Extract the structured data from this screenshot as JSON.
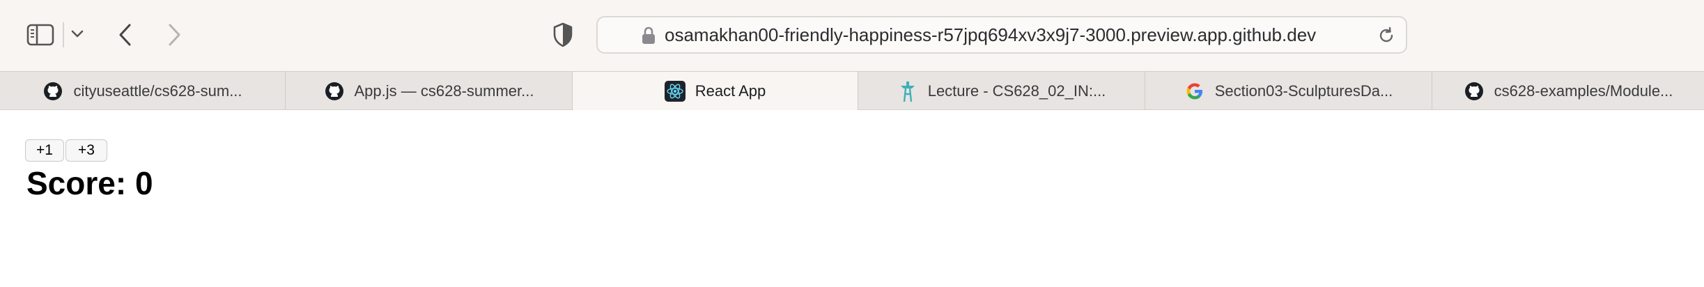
{
  "browser": {
    "url": "osamakhan00-friendly-happiness-r57jpq694xv3x9j7-3000.preview.app.github.dev",
    "tabs": [
      {
        "label": "cityuseattle/cs628-sum...",
        "icon": "github-icon",
        "active": false
      },
      {
        "label": "App.js — cs628-summer...",
        "icon": "github-icon",
        "active": false
      },
      {
        "label": "React App",
        "icon": "react-icon",
        "active": true
      },
      {
        "label": "Lecture - CS628_02_IN:...",
        "icon": "space-needle-icon",
        "active": false
      },
      {
        "label": "Section03-SculpturesDa...",
        "icon": "google-icon",
        "active": false
      },
      {
        "label": "cs628-examples/Module...",
        "icon": "github-icon",
        "active": false
      }
    ]
  },
  "page": {
    "plus_one_label": "+1",
    "plus_three_label": "+3",
    "score_text": "Score: 0"
  },
  "colors": {
    "toolbar_bg": "#f8f5f2",
    "tabstrip_bg": "#e8e4e1",
    "react_blue": "#61dafb"
  }
}
